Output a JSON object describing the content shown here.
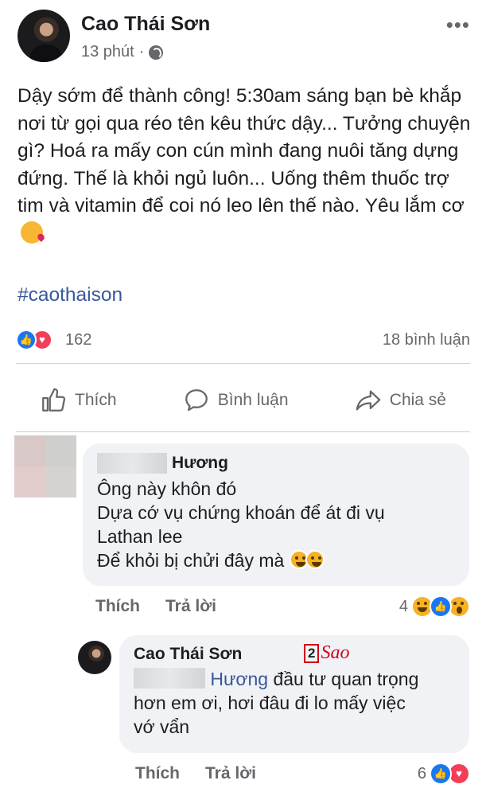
{
  "post": {
    "author": "Cao Thái Sơn",
    "time": "13 phút",
    "separator": "·",
    "privacy_icon": "globe-icon",
    "more_icon": "more-dots-icon",
    "more_label": "•••",
    "text": "Dậy sớm để thành công! 5:30am sáng bạn bè khắp nơi từ gọi qua réo tên kêu thức dậy... Tưởng chuyện gì? Hoá ra mấy con cún mình đang nuôi tăng dựng đứng. Thế là khỏi ngủ luôn... Uống thêm thuốc trợ tim và vitamin để coi nó leo lên thế nào. Yêu lắm cơ",
    "emoji": "kissing-face-icon",
    "hashtag": "#caothaison",
    "reaction_count": "162",
    "comment_count": "18 bình luận"
  },
  "actions": {
    "like": "Thích",
    "comment": "Bình luận",
    "share": "Chia sẻ"
  },
  "comments": [
    {
      "name": "Hương",
      "text_lines": [
        "Ông này khôn đó",
        "Dựa cớ vụ chứng khoán để át đi vụ",
        "Lathan lee",
        "Để khỏi bị chửi đây mà"
      ],
      "emoji": "rolling-laughing-icon",
      "like_label": "Thích",
      "reply_label": "Trả lời",
      "reaction_count": "4"
    },
    {
      "name": "Cao Thái Sơn",
      "mention": "Hương",
      "text_after_mention": " đầu tư quan trọng",
      "text_lines": [
        "hơn em ơi, hơi đâu đi lo mấy việc",
        "vớ vẩn"
      ],
      "like_label": "Thích",
      "reply_label": "Trả lời",
      "reaction_count": "6"
    }
  ],
  "watermark": {
    "number": "2",
    "text": "Sao"
  },
  "colors": {
    "link": "#385898",
    "secondary_text": "#65676b",
    "bubble_bg": "#f0f2f5",
    "like_blue": "#1877f2",
    "love_red": "#f33e58"
  }
}
